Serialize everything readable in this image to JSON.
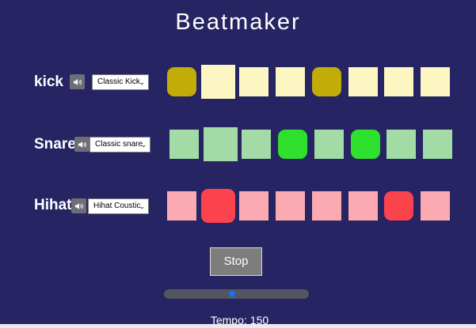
{
  "app": {
    "title": "Beatmaker"
  },
  "icons": {
    "mute": "speaker-icon"
  },
  "tracks": [
    {
      "name": "kick",
      "instrument": "Classic Kick",
      "steps": [
        true,
        false,
        false,
        false,
        true,
        false,
        false,
        false
      ],
      "current_step": 2,
      "colors": {
        "inactive": "#fcf6c3",
        "active": "#c2ac07"
      }
    },
    {
      "name": "Snare",
      "instrument": "Classic snare",
      "steps": [
        false,
        false,
        false,
        true,
        false,
        true,
        false,
        false
      ],
      "current_step": 2,
      "colors": {
        "inactive": "#a2dba5",
        "active": "#2fe02f"
      }
    },
    {
      "name": "Hihat",
      "instrument": "Hihat Coustic",
      "steps": [
        false,
        true,
        false,
        false,
        false,
        false,
        true,
        false
      ],
      "current_step": 2,
      "colors": {
        "inactive": "#fbaab2",
        "active": "#fa434c"
      }
    }
  ],
  "controls": {
    "stop_label": "Stop",
    "tempo_label": "Tempo:",
    "tempo_value": "150",
    "tempo_fraction": 0.47
  }
}
